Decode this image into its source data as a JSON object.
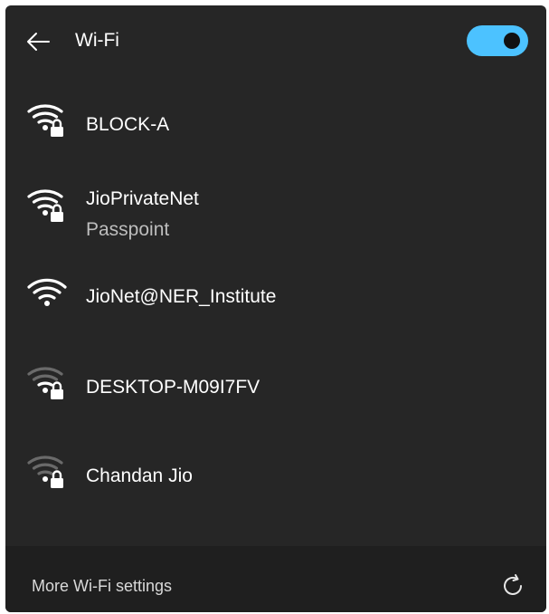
{
  "header": {
    "title": "Wi-Fi",
    "back_icon": "back-arrow-icon",
    "wifi_toggle": {
      "state": "on",
      "accent_color": "#4cc2ff"
    }
  },
  "networks": [
    {
      "name": "BLOCK-A",
      "subtitle": "",
      "secured": true,
      "signal_bars": 4,
      "icon": "wifi-secured-icon"
    },
    {
      "name": "JioPrivateNet",
      "subtitle": "Passpoint",
      "secured": true,
      "signal_bars": 4,
      "icon": "wifi-secured-icon"
    },
    {
      "name": "JioNet@NER_Institute",
      "subtitle": "",
      "secured": false,
      "signal_bars": 4,
      "icon": "wifi-icon"
    },
    {
      "name": "DESKTOP-M09I7FV",
      "subtitle": "",
      "secured": true,
      "signal_bars": 2,
      "icon": "wifi-secured-icon"
    },
    {
      "name": "Chandan Jio",
      "subtitle": "",
      "secured": true,
      "signal_bars": 1,
      "icon": "wifi-secured-icon"
    }
  ],
  "footer": {
    "settings_label": "More Wi-Fi settings",
    "refresh_icon": "refresh-icon"
  },
  "colors": {
    "panel_bg": "#262626",
    "footer_bg": "#1f1f1f",
    "accent": "#4cc2ff",
    "text_primary": "#ffffff",
    "text_secondary": "#bdbdbd"
  }
}
